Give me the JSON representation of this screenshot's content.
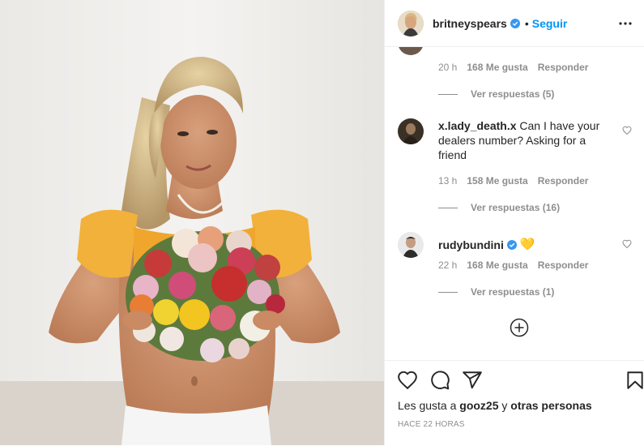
{
  "post": {
    "username": "britneyspears",
    "follow_label": "Seguir",
    "separator": "•"
  },
  "comments": [
    {
      "username": "",
      "text": "",
      "time": "20 h",
      "likes": "168 Me gusta",
      "reply_label": "Responder",
      "view_replies": "Ver respuestas (5)"
    },
    {
      "username": "x.lady_death.x",
      "text": "Can I have your dealers number? Asking for a friend",
      "time": "13 h",
      "likes": "158 Me gusta",
      "reply_label": "Responder",
      "view_replies": "Ver respuestas (16)"
    },
    {
      "username": "rudybundini",
      "text": "💛",
      "time": "22 h",
      "likes": "168 Me gusta",
      "reply_label": "Responder",
      "view_replies": "Ver respuestas (1)"
    }
  ],
  "likes_line": {
    "prefix": "Les gusta a",
    "user": "gooz25",
    "connector": "y",
    "rest": "otras personas"
  },
  "posted_ago": "HACE 22 HORAS",
  "colors": {
    "accent": "#0095f6",
    "text": "#262626",
    "muted": "#8e8e8e"
  },
  "icons": [
    "more-options-icon",
    "verified-badge-icon",
    "heart-icon",
    "comment-icon",
    "share-icon",
    "bookmark-icon",
    "add-comment-icon"
  ]
}
